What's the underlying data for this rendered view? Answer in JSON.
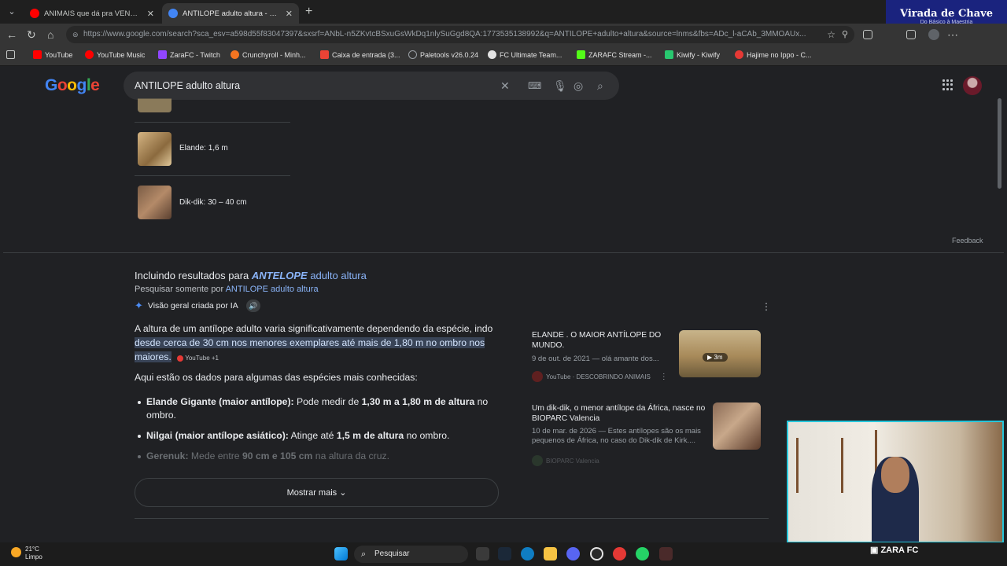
{
  "browser": {
    "tabs": [
      {
        "title": "ANIMAIS que dá pra VENCER no S",
        "favicon_color": "#ff0000"
      },
      {
        "title": "ANTILOPE adulto altura - Pesquisa",
        "favicon_color": "#4285f4"
      }
    ],
    "url": "https://www.google.com/search?sca_esv=a598d55f83047397&sxsrf=ANbL-n5ZKvtcBSxuGsWkDq1nlySuGgd8QA:1773535138992&q=ANTILOPE+adulto+altura&source=lnms&fbs=ADc_l-aCAb_3MMOAUx..."
  },
  "bookmarks": [
    {
      "label": "YouTube",
      "color": "#ff0000"
    },
    {
      "label": "YouTube Music",
      "color": "#ff0000"
    },
    {
      "label": "ZaraFC - Twitch",
      "color": "#9146ff"
    },
    {
      "label": "Crunchyroll - Minh...",
      "color": "#f47521"
    },
    {
      "label": "Caixa de entrada (3...",
      "color": "#ea4335"
    },
    {
      "label": "Paletools v26.0.24",
      "color": "#9aa0a6"
    },
    {
      "label": "FC Ultimate Team...",
      "color": "#e3e3e3"
    },
    {
      "label": "ZARAFC Stream -...",
      "color": "#53fc18"
    },
    {
      "label": "Kiwify - Kiwify",
      "color": "#28c76f"
    },
    {
      "label": "Hajime no Ippo - C...",
      "color": "#e53935"
    }
  ],
  "overlay_brand": {
    "title": "Virada de Chave",
    "subtitle": "Do Básico à Maestria"
  },
  "google": {
    "logo": "Google",
    "query": "ANTILOPE adulto altura",
    "top_list": [
      {
        "label": "Elande: 1,6 m"
      },
      {
        "label": "Dik-dik: 30 – 40 cm"
      }
    ],
    "feedback": "Feedback",
    "including_prefix": "Incluindo resultados para",
    "including_term": "ANTELOPE",
    "including_rest": "adulto altura",
    "only_prefix": "Pesquisar somente por",
    "only_link": "ANTILOPE adulto altura",
    "ai_label": "Visão geral criada por IA",
    "ai_para1_start": "A altura de um antílope adulto varia significativamente dependendo da espécie, indo",
    "ai_para1_highlight": "desde cerca de 30 cm nos menores exemplares até mais de 1,80 m no ombro nos maiores",
    "ai_source_chip": "YouTube +1",
    "ai_para2": "Aqui estão os dados para algumas das espécies mais conhecidas:",
    "bullets": [
      {
        "bold": "Elande Gigante (maior antílope):",
        "text_a": " Pode medir de ",
        "bold2": "1,30 m a 1,80 m de altura",
        "text_b": " no ombro."
      },
      {
        "bold": "Nilgai (maior antílope asiático):",
        "text_a": " Atinge até ",
        "bold2": "1,5 m de altura",
        "text_b": " no ombro."
      },
      {
        "bold": "Gerenuk:",
        "text_a": " Mede entre ",
        "bold2": "90 cm e 105 cm",
        "text_b": " na altura da cruz."
      }
    ],
    "show_more": "Mostrar mais",
    "cards": [
      {
        "title": "ELANDE . O MAIOR ANTÍLOPE DO MUNDO.",
        "date": "9 de out. de 2021 — olá amante dos...",
        "source": "YouTube · DESCOBRINDO ANIMAIS",
        "duration": "3m"
      },
      {
        "title": "Um dik-dik, o menor antílope da África, nasce no BIOPARC Valencia",
        "date": "10 de mar. de 2026 — Estes antílopes são os mais pequenos de África, no caso do Dik-dik de Kirk....",
        "source": "BIOPARC Valencia"
      }
    ]
  },
  "taskbar": {
    "temp": "21°C",
    "weather": "Limpo",
    "search": "Pesquisar",
    "stream_label": "ZARA FC"
  }
}
